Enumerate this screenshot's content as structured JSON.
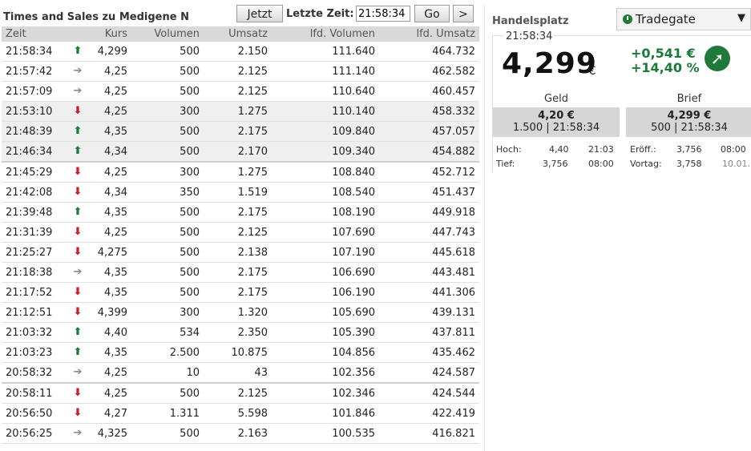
{
  "left": {
    "title": "Times and Sales zu Medigene N",
    "jetzt_label": "Jetzt",
    "letzte_zeit_label": "Letzte Zeit:",
    "time_value": "21:58:34",
    "go_label": "Go",
    "next_label": ">",
    "columns": [
      "Zeit",
      "Kurs",
      "Volumen",
      "Umsatz",
      "lfd. Volumen",
      "lfd. Umsatz"
    ],
    "rows": [
      {
        "zeit": "21:58:34",
        "dir": "up",
        "kurs": "4,299",
        "volumen": "500",
        "umsatz": "2.150",
        "lfd_volumen": "111.640",
        "lfd_umsatz": "464.732"
      },
      {
        "zeit": "21:57:42",
        "dir": "flat",
        "kurs": "4,25",
        "volumen": "500",
        "umsatz": "2.125",
        "lfd_volumen": "111.140",
        "lfd_umsatz": "462.582"
      },
      {
        "zeit": "21:57:09",
        "dir": "flat",
        "kurs": "4,25",
        "volumen": "500",
        "umsatz": "2.125",
        "lfd_volumen": "110.640",
        "lfd_umsatz": "460.457"
      },
      {
        "zeit": "21:53:10",
        "dir": "down",
        "kurs": "4,25",
        "volumen": "300",
        "umsatz": "1.275",
        "lfd_volumen": "110.140",
        "lfd_umsatz": "458.332"
      },
      {
        "zeit": "21:48:39",
        "dir": "up",
        "kurs": "4,35",
        "volumen": "500",
        "umsatz": "2.175",
        "lfd_volumen": "109.840",
        "lfd_umsatz": "457.057"
      },
      {
        "zeit": "21:46:34",
        "dir": "up",
        "kurs": "4,34",
        "volumen": "500",
        "umsatz": "2.170",
        "lfd_volumen": "109.340",
        "lfd_umsatz": "454.882"
      },
      {
        "zeit": "21:45:29",
        "dir": "down",
        "kurs": "4,25",
        "volumen": "300",
        "umsatz": "1.275",
        "lfd_volumen": "108.840",
        "lfd_umsatz": "452.712"
      },
      {
        "zeit": "21:42:08",
        "dir": "down",
        "kurs": "4,34",
        "volumen": "350",
        "umsatz": "1.519",
        "lfd_volumen": "108.540",
        "lfd_umsatz": "451.437"
      },
      {
        "zeit": "21:39:48",
        "dir": "up",
        "kurs": "4,35",
        "volumen": "500",
        "umsatz": "2.175",
        "lfd_volumen": "108.190",
        "lfd_umsatz": "449.918"
      },
      {
        "zeit": "21:31:39",
        "dir": "down",
        "kurs": "4,25",
        "volumen": "500",
        "umsatz": "2.125",
        "lfd_volumen": "107.690",
        "lfd_umsatz": "447.743"
      },
      {
        "zeit": "21:25:27",
        "dir": "down",
        "kurs": "4,275",
        "volumen": "500",
        "umsatz": "2.138",
        "lfd_volumen": "107.190",
        "lfd_umsatz": "445.618"
      },
      {
        "zeit": "21:18:38",
        "dir": "flat",
        "kurs": "4,35",
        "volumen": "500",
        "umsatz": "2.175",
        "lfd_volumen": "106.690",
        "lfd_umsatz": "443.481"
      },
      {
        "zeit": "21:17:52",
        "dir": "down",
        "kurs": "4,35",
        "volumen": "500",
        "umsatz": "2.175",
        "lfd_volumen": "106.190",
        "lfd_umsatz": "441.306"
      },
      {
        "zeit": "21:12:51",
        "dir": "down",
        "kurs": "4,399",
        "volumen": "300",
        "umsatz": "1.320",
        "lfd_volumen": "105.690",
        "lfd_umsatz": "439.131"
      },
      {
        "zeit": "21:03:32",
        "dir": "up",
        "kurs": "4,40",
        "volumen": "534",
        "umsatz": "2.350",
        "lfd_volumen": "105.390",
        "lfd_umsatz": "437.811"
      },
      {
        "zeit": "21:03:23",
        "dir": "up",
        "kurs": "4,35",
        "volumen": "2.500",
        "umsatz": "10.875",
        "lfd_volumen": "104.856",
        "lfd_umsatz": "435.462"
      },
      {
        "zeit": "20:58:32",
        "dir": "flat",
        "kurs": "4,25",
        "volumen": "10",
        "umsatz": "43",
        "lfd_volumen": "102.356",
        "lfd_umsatz": "424.587"
      },
      {
        "zeit": "20:58:11",
        "dir": "down",
        "kurs": "4,25",
        "volumen": "500",
        "umsatz": "2.125",
        "lfd_volumen": "102.346",
        "lfd_umsatz": "424.544"
      },
      {
        "zeit": "20:56:50",
        "dir": "down",
        "kurs": "4,27",
        "volumen": "1.311",
        "umsatz": "5.598",
        "lfd_volumen": "101.846",
        "lfd_umsatz": "422.419"
      },
      {
        "zeit": "20:56:25",
        "dir": "flat",
        "kurs": "4,325",
        "volumen": "500",
        "umsatz": "2.163",
        "lfd_volumen": "100.535",
        "lfd_umsatz": "416.821"
      }
    ]
  },
  "right": {
    "handelsplatz_label": "Handelsplatz",
    "exchange": "Tradegate",
    "quote_time": "21:58:34",
    "price": "4,299",
    "currency": "€",
    "change_abs": "+0,541 €",
    "change_pct": "+14,40 %",
    "geld_label": "Geld",
    "brief_label": "Brief",
    "geld_price": "4,20 €",
    "geld_detail": "1.500 | 21:58:34",
    "brief_price": "4,299 €",
    "brief_detail": "500 | 21:58:34",
    "hoch_label": "Hoch:",
    "hoch_value": "4,40",
    "hoch_time": "21:03",
    "tief_label": "Tief:",
    "tief_value": "3,756",
    "tief_time": "08:00",
    "eroeff_label": "Eröff.:",
    "eroeff_value": "3,756",
    "eroeff_time": "08:00",
    "vortag_label": "Vortag:",
    "vortag_value": "3,758",
    "vortag_date": "10.01."
  },
  "colors": {
    "up": "#1a7a3a",
    "down": "#c8202a",
    "flat": "#888888",
    "header_bg": "#d9d9d9"
  },
  "icons": {
    "up": "arrow-up-icon",
    "down": "arrow-down-icon",
    "flat": "arrow-right-icon",
    "trend": "trend-up-icon",
    "clock": "clock-icon",
    "caret": "chevron-down-icon"
  }
}
